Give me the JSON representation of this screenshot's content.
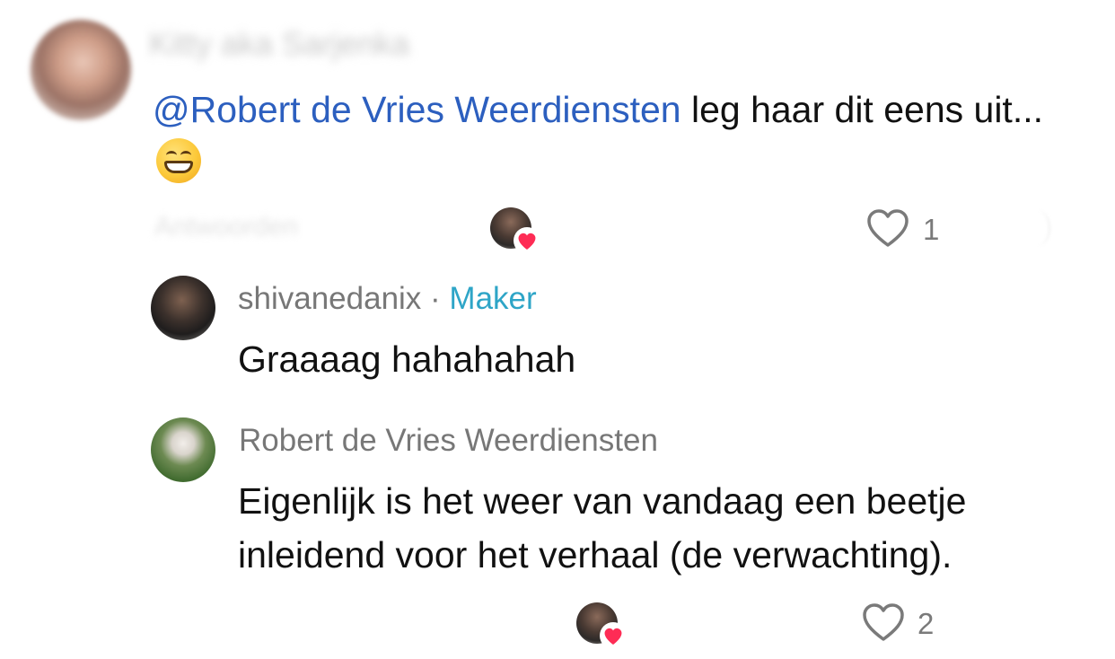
{
  "comment": {
    "author": "Kitty aka Sarjenka",
    "mention": "@Robert de Vries Weerdiensten",
    "text": " leg haar dit eens uit...",
    "emoji": "grinning-face-emoji",
    "actions_label": "Antwoorden",
    "likes": "1"
  },
  "replies": [
    {
      "author": "shivanedanix",
      "separator": " · ",
      "badge": "Maker",
      "text": "Graaaag hahahahah"
    },
    {
      "author": "Robert de Vries Weerdiensten",
      "text": "Eigenlijk is het weer van vandaag een beetje inleidend voor het verhaal (de verwachting).",
      "likes": "2"
    }
  ],
  "colors": {
    "mention": "#2c5fbf",
    "maker_badge": "#2ea5c7",
    "heart_badge": "#fe2c55",
    "meta_text": "#777777"
  }
}
